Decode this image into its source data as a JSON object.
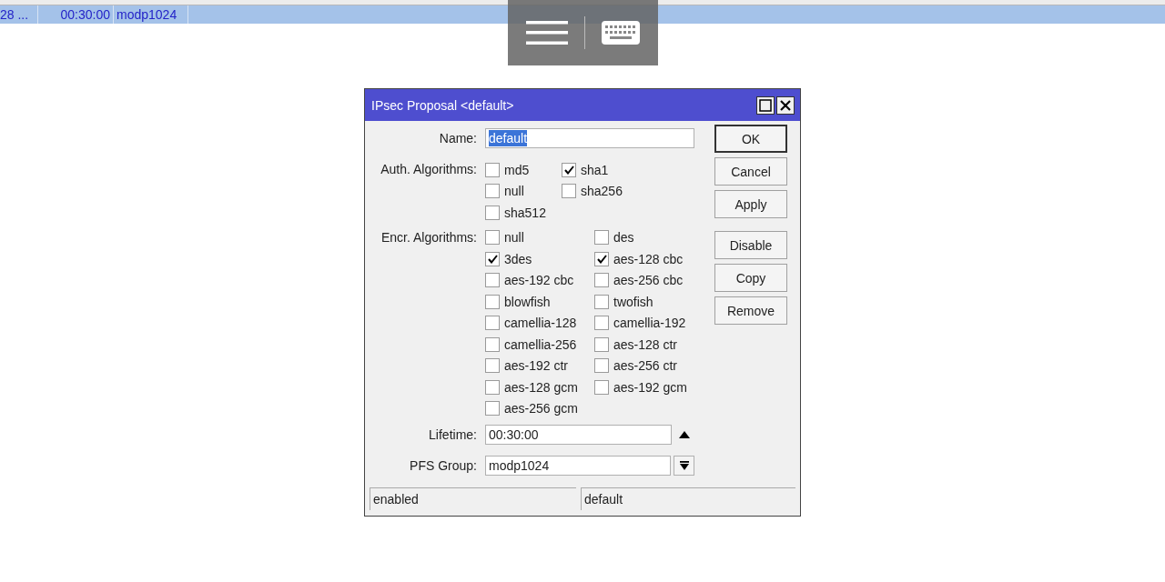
{
  "background_table": {
    "row": {
      "selected": true,
      "cells": [
        "28 ...",
        "00:30:00",
        "modp1024"
      ]
    }
  },
  "dialog": {
    "title": "IPsec Proposal <default>",
    "name": {
      "label": "Name:",
      "value": "default",
      "selected": true
    },
    "auth": {
      "label": "Auth. Algorithms:",
      "options": [
        {
          "label": "md5",
          "checked": false
        },
        {
          "label": "sha1",
          "checked": true
        },
        {
          "label": "null",
          "checked": false
        },
        {
          "label": "sha256",
          "checked": false
        },
        {
          "label": "sha512",
          "checked": false
        }
      ]
    },
    "encr": {
      "label": "Encr. Algorithms:",
      "options": [
        {
          "label": "null",
          "checked": false
        },
        {
          "label": "des",
          "checked": false
        },
        {
          "label": "3des",
          "checked": true
        },
        {
          "label": "aes-128 cbc",
          "checked": true
        },
        {
          "label": "aes-192 cbc",
          "checked": false
        },
        {
          "label": "aes-256 cbc",
          "checked": false
        },
        {
          "label": "blowfish",
          "checked": false
        },
        {
          "label": "twofish",
          "checked": false
        },
        {
          "label": "camellia-128",
          "checked": false
        },
        {
          "label": "camellia-192",
          "checked": false
        },
        {
          "label": "camellia-256",
          "checked": false
        },
        {
          "label": "aes-128 ctr",
          "checked": false
        },
        {
          "label": "aes-192 ctr",
          "checked": false
        },
        {
          "label": "aes-256 ctr",
          "checked": false
        },
        {
          "label": "aes-128 gcm",
          "checked": false
        },
        {
          "label": "aes-192 gcm",
          "checked": false
        },
        {
          "label": "aes-256 gcm",
          "checked": false
        }
      ]
    },
    "lifetime": {
      "label": "Lifetime:",
      "value": "00:30:00"
    },
    "pfs_group": {
      "label": "PFS Group:",
      "value": "modp1024"
    },
    "buttons": [
      "OK",
      "Cancel",
      "Apply",
      "Disable",
      "Copy",
      "Remove"
    ],
    "status_bar": [
      "enabled",
      "default"
    ]
  }
}
